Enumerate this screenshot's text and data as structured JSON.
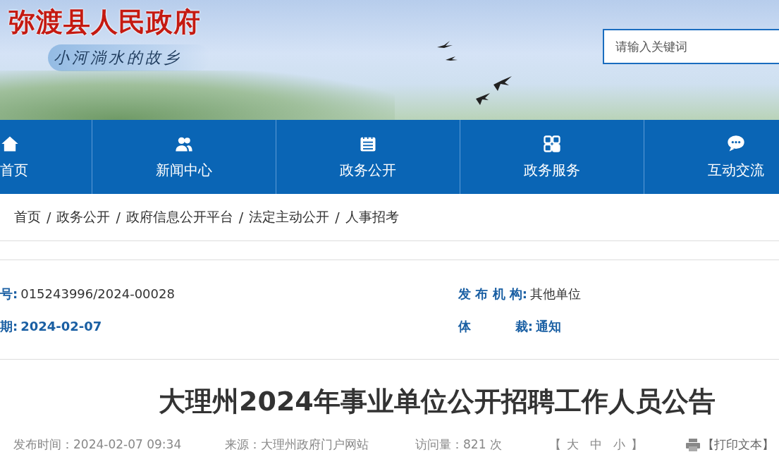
{
  "header": {
    "site_title": "弥渡县人民政府",
    "slogan": "小河淌水的故乡",
    "search": {
      "placeholder": "请输入关键词"
    }
  },
  "nav": [
    {
      "label": "首页"
    },
    {
      "label": "新闻中心"
    },
    {
      "label": "政务公开"
    },
    {
      "label": "政务服务"
    },
    {
      "label": "互动交流"
    }
  ],
  "breadcrumb": {
    "separator": "/",
    "items": [
      "首页",
      "政务公开",
      "政府信息公开平台",
      "法定主动公开",
      "人事招考"
    ]
  },
  "meta": [
    {
      "label": "号:",
      "value": "015243996/2024-00028",
      "emphasis": false
    },
    {
      "label": "发 布 机 构:",
      "value": "其他单位",
      "emphasis": false
    },
    {
      "label": "期:",
      "value": "2024-02-07",
      "emphasis": true
    },
    {
      "label": "体          裁:",
      "value": "通知",
      "emphasis": true
    }
  ],
  "article": {
    "title": "大理州2024年事业单位公开招聘工作人员公告",
    "publish_time": "发布时间：2024-02-07 09:34",
    "source": "来源：大理州政府门户网站",
    "views": "访问量：821 次",
    "font_open": "【",
    "font_sizes": [
      "大",
      "中",
      "小"
    ],
    "font_close": "】",
    "print": "【打印文本】"
  }
}
